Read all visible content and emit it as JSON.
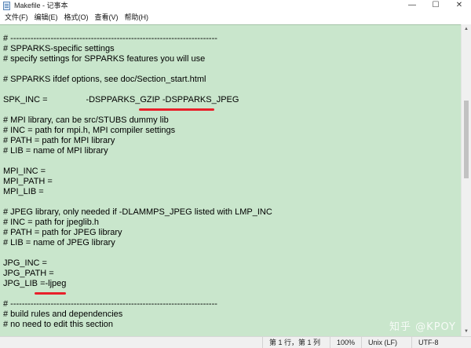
{
  "window": {
    "title": "Makefile - 记事本",
    "controls": {
      "minimize": "—",
      "maximize": "☐",
      "close": "✕"
    }
  },
  "menu": {
    "items": [
      {
        "label": "文件(F)"
      },
      {
        "label": "编辑(E)"
      },
      {
        "label": "格式(O)"
      },
      {
        "label": "查看(V)"
      },
      {
        "label": "帮助(H)"
      }
    ]
  },
  "editor": {
    "background_color": "#c9e6cc",
    "lines": [
      "# ------------------------------------------------------------------------",
      "# SPPARKS-specific settings",
      "# specify settings for SPPARKS features you will use",
      "",
      "# SPPARKS ifdef options, see doc/Section_start.html",
      "",
      "SPK_INC =                -DSPPARKS_GZIP -DSPPARKS_JPEG",
      "",
      "# MPI library, can be src/STUBS dummy lib",
      "# INC = path for mpi.h, MPI compiler settings",
      "# PATH = path for MPI library",
      "# LIB = name of MPI library",
      "",
      "MPI_INC =",
      "MPI_PATH =",
      "MPI_LIB =",
      "",
      "# JPEG library, only needed if -DLAMMPS_JPEG listed with LMP_INC",
      "# INC = path for jpeglib.h",
      "# PATH = path for JPEG library",
      "# LIB = name of JPEG library",
      "",
      "JPG_INC =",
      "JPG_PATH =",
      "JPG_LIB =-ljpeg",
      "",
      "# ------------------------------------------------------------------------",
      "# build rules and dependencies",
      "# no need to edit this section"
    ]
  },
  "annotation_color": "#e8202a",
  "watermark": "知乎 @KPOY",
  "statusbar": {
    "position": "第 1 行，第 1 列",
    "zoom": "100%",
    "line_ending": "Unix (LF)",
    "encoding": "UTF-8"
  }
}
